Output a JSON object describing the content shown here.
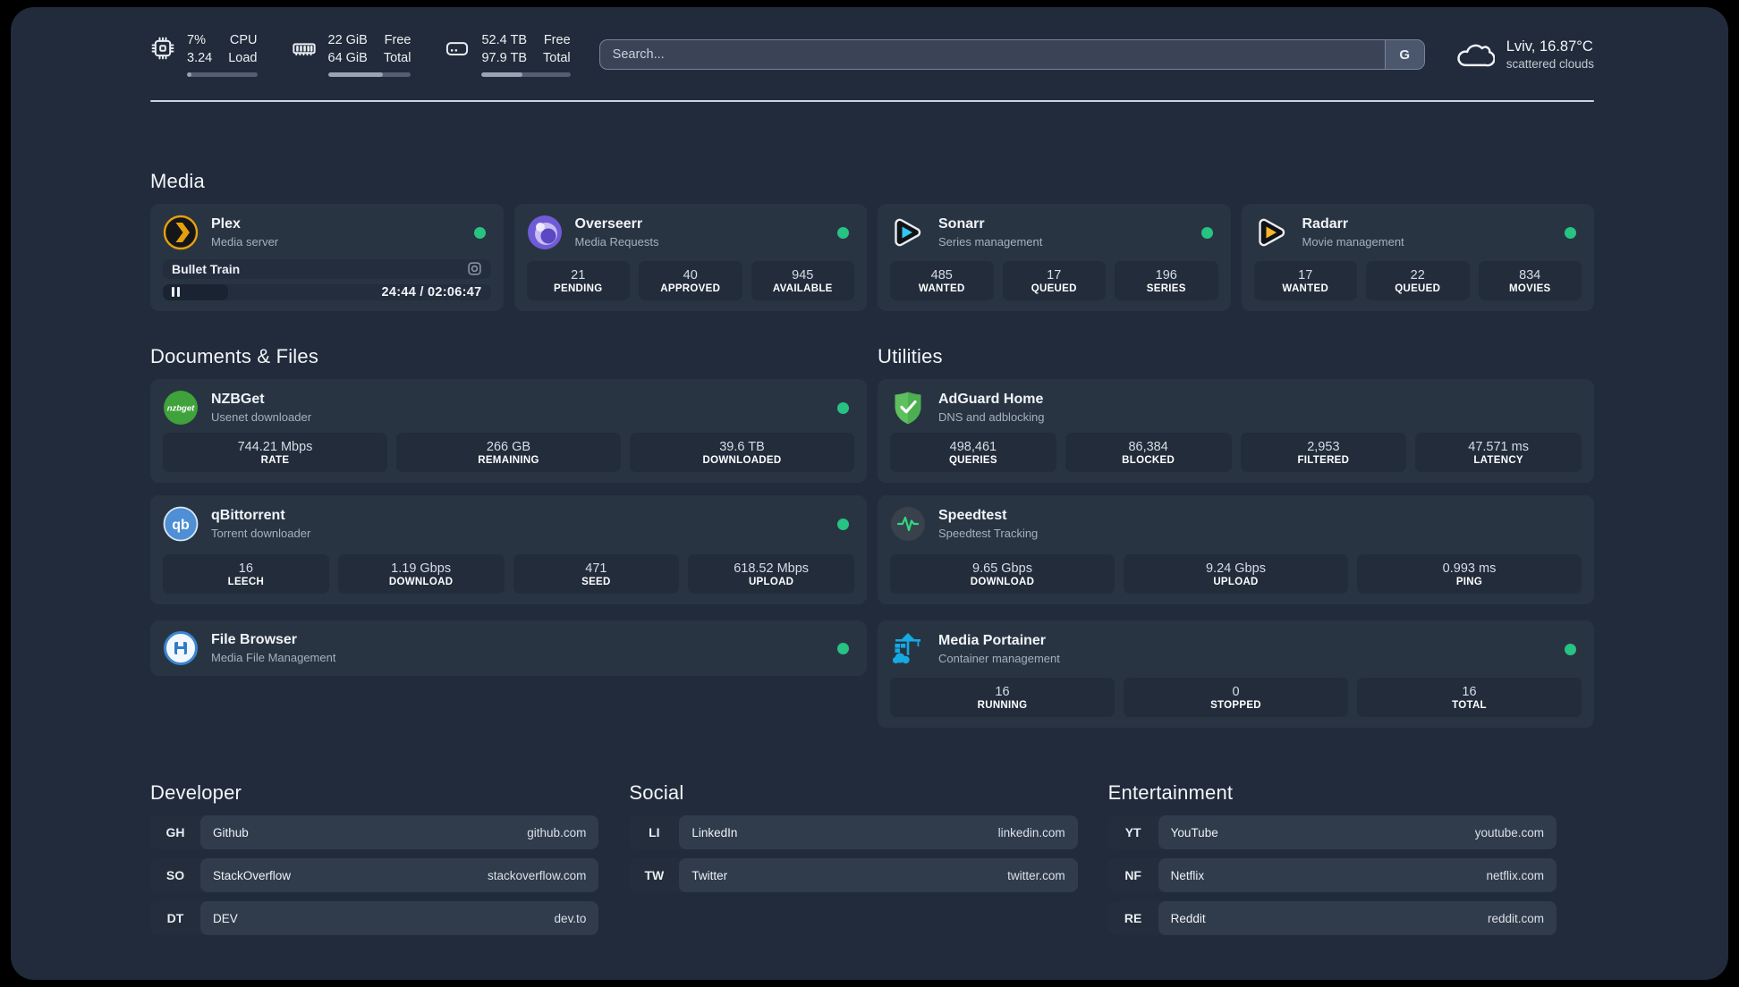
{
  "colors": {
    "accent_green": "#26c383",
    "background": "#212b3b",
    "card": "#293443",
    "stat_box": "#222c3b"
  },
  "header": {
    "stats": [
      {
        "icon": "cpu-icon",
        "value_top": "7%",
        "value_bottom": "3.24",
        "label_top": "CPU",
        "label_bottom": "Load",
        "progress": 7
      },
      {
        "icon": "ram-icon",
        "value_top": "22 GiB",
        "value_bottom": "64 GiB",
        "label_top": "Free",
        "label_bottom": "Total",
        "progress": 66
      },
      {
        "icon": "disk-icon",
        "value_top": "52.4 TB",
        "value_bottom": "97.9 TB",
        "label_top": "Free",
        "label_bottom": "Total",
        "progress": 46
      }
    ],
    "search": {
      "placeholder": "Search...",
      "button_label": "G"
    },
    "weather": {
      "icon": "cloud-icon",
      "location_temp": "Lviv, 16.87°C",
      "condition": "scattered clouds"
    }
  },
  "media": {
    "title": "Media",
    "cards": [
      {
        "icon": "plex-icon",
        "name": "Plex",
        "desc": "Media server",
        "online": true,
        "player": {
          "track": "Bullet Train",
          "time": "24:44 / 02:06:47",
          "progress": 20
        }
      },
      {
        "icon": "overseerr-icon",
        "name": "Overseerr",
        "desc": "Media Requests",
        "online": true,
        "stats": [
          {
            "value": "21",
            "label": "PENDING"
          },
          {
            "value": "40",
            "label": "APPROVED"
          },
          {
            "value": "945",
            "label": "AVAILABLE"
          }
        ]
      },
      {
        "icon": "sonarr-icon",
        "name": "Sonarr",
        "desc": "Series management",
        "online": true,
        "stats": [
          {
            "value": "485",
            "label": "WANTED"
          },
          {
            "value": "17",
            "label": "QUEUED"
          },
          {
            "value": "196",
            "label": "SERIES"
          }
        ]
      },
      {
        "icon": "radarr-icon",
        "name": "Radarr",
        "desc": "Movie management",
        "online": true,
        "stats": [
          {
            "value": "17",
            "label": "WANTED"
          },
          {
            "value": "22",
            "label": "QUEUED"
          },
          {
            "value": "834",
            "label": "MOVIES"
          }
        ]
      }
    ]
  },
  "documents": {
    "title": "Documents & Files",
    "cards": [
      {
        "icon": "nzbget-icon",
        "icon_text": "nzbget",
        "name": "NZBGet",
        "desc": "Usenet downloader",
        "online": true,
        "stats": [
          {
            "value": "744.21 Mbps",
            "label": "RATE"
          },
          {
            "value": "266 GB",
            "label": "REMAINING"
          },
          {
            "value": "39.6 TB",
            "label": "DOWNLOADED"
          }
        ]
      },
      {
        "icon": "qbittorrent-icon",
        "icon_text": "qb",
        "name": "qBittorrent",
        "desc": "Torrent downloader",
        "online": true,
        "stats": [
          {
            "value": "16",
            "label": "LEECH"
          },
          {
            "value": "1.19 Gbps",
            "label": "DOWNLOAD"
          },
          {
            "value": "471",
            "label": "SEED"
          },
          {
            "value": "618.52 Mbps",
            "label": "UPLOAD"
          }
        ]
      },
      {
        "icon": "filebrowser-icon",
        "name": "File Browser",
        "desc": "Media File Management",
        "online": true
      }
    ]
  },
  "utilities": {
    "title": "Utilities",
    "cards": [
      {
        "icon": "adguard-icon",
        "name": "AdGuard Home",
        "desc": "DNS and adblocking",
        "online": false,
        "stats": [
          {
            "value": "498,461",
            "label": "QUERIES"
          },
          {
            "value": "86,384",
            "label": "BLOCKED"
          },
          {
            "value": "2,953",
            "label": "FILTERED"
          },
          {
            "value": "47.571 ms",
            "label": "LATENCY"
          }
        ]
      },
      {
        "icon": "speedtest-icon",
        "name": "Speedtest",
        "desc": "Speedtest Tracking",
        "online": false,
        "stats": [
          {
            "value": "9.65 Gbps",
            "label": "DOWNLOAD"
          },
          {
            "value": "9.24 Gbps",
            "label": "UPLOAD"
          },
          {
            "value": "0.993 ms",
            "label": "PING"
          }
        ]
      },
      {
        "icon": "portainer-icon",
        "name": "Media Portainer",
        "desc": "Container management",
        "online": true,
        "stats": [
          {
            "value": "16",
            "label": "RUNNING"
          },
          {
            "value": "0",
            "label": "STOPPED"
          },
          {
            "value": "16",
            "label": "TOTAL"
          }
        ]
      }
    ]
  },
  "links": [
    {
      "title": "Developer",
      "items": [
        {
          "abbr": "GH",
          "name": "Github",
          "url": "github.com"
        },
        {
          "abbr": "SO",
          "name": "StackOverflow",
          "url": "stackoverflow.com"
        },
        {
          "abbr": "DT",
          "name": "DEV",
          "url": "dev.to"
        }
      ]
    },
    {
      "title": "Social",
      "items": [
        {
          "abbr": "LI",
          "name": "LinkedIn",
          "url": "linkedin.com"
        },
        {
          "abbr": "TW",
          "name": "Twitter",
          "url": "twitter.com"
        }
      ]
    },
    {
      "title": "Entertainment",
      "items": [
        {
          "abbr": "YT",
          "name": "YouTube",
          "url": "youtube.com"
        },
        {
          "abbr": "NF",
          "name": "Netflix",
          "url": "netflix.com"
        },
        {
          "abbr": "RE",
          "name": "Reddit",
          "url": "reddit.com"
        }
      ]
    }
  ]
}
